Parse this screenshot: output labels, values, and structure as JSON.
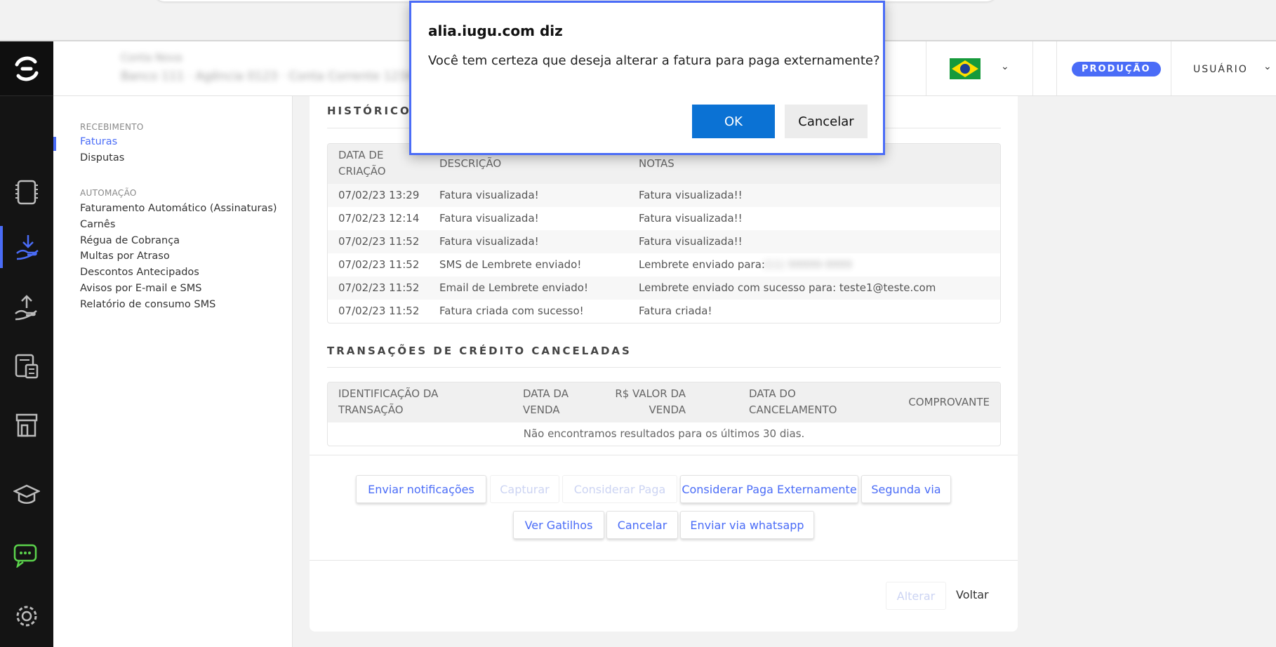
{
  "header": {
    "account_line1": "Conta Nova",
    "account_line2": "Banco 111 · Agência 0123 · Conta Corrente 12345",
    "badge": "PRODUÇÃO",
    "user": "USUÁRIO"
  },
  "sidebar": {
    "sections": [
      {
        "title": "RECEBIMENTO",
        "items": [
          "Faturas",
          "Disputas"
        ]
      },
      {
        "title": "AUTOMAÇÃO",
        "items": [
          "Faturamento Automático (Assinaturas)",
          "Carnês",
          "Régua de Cobrança",
          "Multas por Atraso",
          "Descontos Antecipados",
          "Avisos por E-mail e SMS",
          "Relatório de consumo SMS"
        ]
      }
    ],
    "active_item": "Faturas"
  },
  "historico": {
    "title": "HISTÓRICO",
    "headers": [
      "DATA DE CRIAÇÃO",
      "DESCRIÇÃO",
      "NOTAS"
    ],
    "rows": [
      {
        "date": "07/02/23 13:29",
        "desc": "Fatura visualizada!",
        "note": "Fatura visualizada!!"
      },
      {
        "date": "07/02/23 12:14",
        "desc": "Fatura visualizada!",
        "note": "Fatura visualizada!!"
      },
      {
        "date": "07/02/23 11:52",
        "desc": "Fatura visualizada!",
        "note": "Fatura visualizada!!"
      },
      {
        "date": "07/02/23 11:52",
        "desc": "SMS de Lembrete enviado!",
        "note": "Lembrete enviado para:",
        "redacted": "(11) 99999-9999"
      },
      {
        "date": "07/02/23 11:52",
        "desc": "Email de Lembrete enviado!",
        "note": "Lembrete enviado com sucesso para: teste1@teste.com"
      },
      {
        "date": "07/02/23 11:52",
        "desc": "Fatura criada com sucesso!",
        "note": "Fatura criada!"
      }
    ]
  },
  "transacoes": {
    "title": "TRANSAÇÕES DE CRÉDITO CANCELADAS",
    "headers": [
      "IDENTIFICAÇÃO DA TRANSAÇÃO",
      "DATA DA VENDA",
      "R$ VALOR DA VENDA",
      "DATA DO CANCELAMENTO",
      "COMPROVANTE"
    ],
    "empty": "Não encontramos resultados para os últimos 30 dias."
  },
  "actions": {
    "row1": [
      "Enviar notificações",
      "Capturar",
      "Considerar Paga",
      "Considerar Paga Externamente",
      "Segunda via"
    ],
    "row2": [
      "Ver Gatilhos",
      "Cancelar",
      "Enviar via whatsapp"
    ]
  },
  "footer": {
    "alterar": "Alterar",
    "voltar": "Voltar"
  },
  "dialog": {
    "title": "alia.iugu.com diz",
    "message": "Você tem certeza que deseja alterar a fatura para paga externamente?",
    "ok": "OK",
    "cancel": "Cancelar"
  },
  "colors": {
    "accent": "#4a6cf7",
    "dialog_ok": "#0b72d4",
    "iconbar": "#141414"
  }
}
